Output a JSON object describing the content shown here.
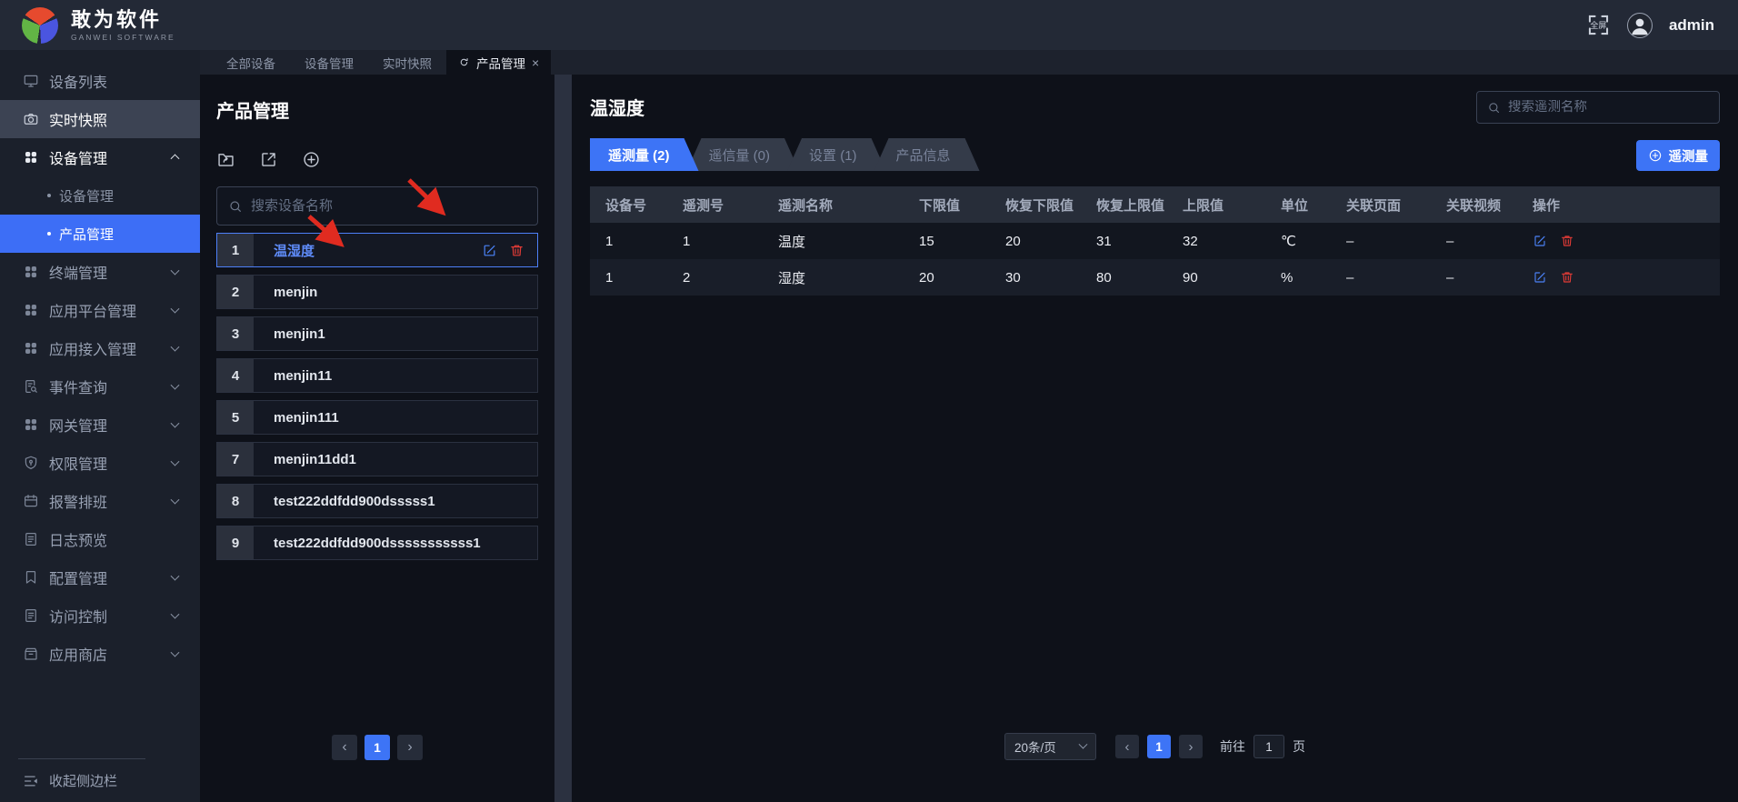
{
  "topbar": {
    "brand": "敢为软件",
    "brand_sub": "GANWEI  SOFTWARE",
    "fullscreen_label": "全屏",
    "username": "admin"
  },
  "tabstrip": {
    "tabs": [
      {
        "label": "全部设备"
      },
      {
        "label": "设备管理"
      },
      {
        "label": "实时快照"
      }
    ],
    "active_tab": {
      "label": "产品管理",
      "close": "×"
    }
  },
  "sidebar": {
    "items": [
      {
        "label": "设备列表",
        "icon": "monitor-icon"
      },
      {
        "label": "实时快照",
        "icon": "camera-icon",
        "highlighted": true
      },
      {
        "label": "设备管理",
        "icon": "grid-icon",
        "expanded": true,
        "children": [
          {
            "label": "设备管理"
          },
          {
            "label": "产品管理",
            "selected": true
          }
        ]
      },
      {
        "label": "终端管理",
        "icon": "grid-icon"
      },
      {
        "label": "应用平台管理",
        "icon": "grid-icon"
      },
      {
        "label": "应用接入管理",
        "icon": "grid-icon"
      },
      {
        "label": "事件查询",
        "icon": "doc-search-icon"
      },
      {
        "label": "网关管理",
        "icon": "grid-icon"
      },
      {
        "label": "权限管理",
        "icon": "shield-icon"
      },
      {
        "label": "报警排班",
        "icon": "calendar-icon"
      },
      {
        "label": "日志预览",
        "icon": "doc-icon"
      },
      {
        "label": "配置管理",
        "icon": "bookmark-icon"
      },
      {
        "label": "访问控制",
        "icon": "doc-icon"
      },
      {
        "label": "应用商店",
        "icon": "store-icon"
      }
    ],
    "collapse_label": "收起侧边栏"
  },
  "left_panel": {
    "title": "产品管理",
    "search_placeholder": "搜索设备名称",
    "items": [
      {
        "num": "1",
        "label": "温湿度",
        "selected": true
      },
      {
        "num": "2",
        "label": "menjin"
      },
      {
        "num": "3",
        "label": "menjin1"
      },
      {
        "num": "4",
        "label": "menjin11"
      },
      {
        "num": "5",
        "label": "menjin111"
      },
      {
        "num": "7",
        "label": "menjin11dd1"
      },
      {
        "num": "8",
        "label": "test222ddfdd900dsssss1"
      },
      {
        "num": "9",
        "label": "test222ddfdd900dsssssssssss1"
      }
    ],
    "pagination": {
      "prev": "‹",
      "page": "1",
      "next": "›"
    }
  },
  "main_panel": {
    "title": "温湿度",
    "search_placeholder": "搜索遥测名称",
    "tabs": [
      {
        "label": "遥测量 (2)",
        "active": true
      },
      {
        "label": "遥信量 (0)"
      },
      {
        "label": "设置 (1)"
      },
      {
        "label": "产品信息"
      }
    ],
    "add_button": "遥测量",
    "table": {
      "headers": [
        "设备号",
        "遥测号",
        "遥测名称",
        "下限值",
        "恢复下限值",
        "恢复上限值",
        "上限值",
        "单位",
        "关联页面",
        "关联视频",
        "操作"
      ],
      "rows": [
        {
          "cells": [
            "1",
            "1",
            "温度",
            "15",
            "20",
            "31",
            "32",
            "℃",
            "–",
            "–"
          ]
        },
        {
          "cells": [
            "1",
            "2",
            "湿度",
            "20",
            "30",
            "80",
            "90",
            "%",
            "–",
            "–"
          ]
        }
      ]
    },
    "pagination": {
      "page_size": "20条/页",
      "prev": "‹",
      "page": "1",
      "next": "›",
      "goto_label": "前往",
      "goto_value": "1",
      "goto_unit": "页"
    }
  },
  "colors": {
    "accent": "#3d74f6",
    "danger": "#e23b36",
    "annotation": "#e02b20",
    "sidebar_selected": "#3d6ef6"
  }
}
